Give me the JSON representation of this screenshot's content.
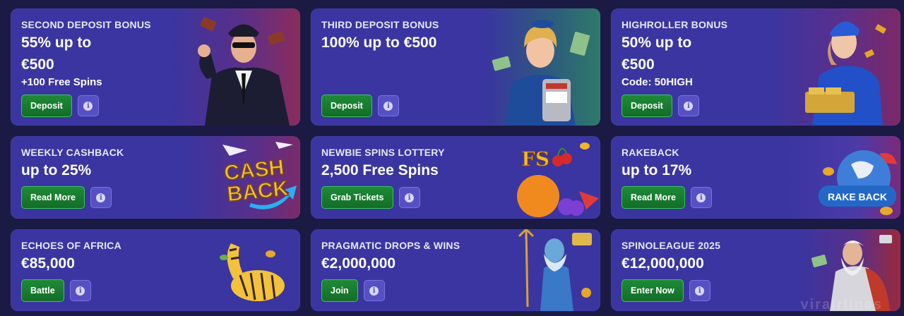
{
  "cards": [
    {
      "eyebrow": "SECOND DEPOSIT BONUS",
      "headline_1": "55% up to",
      "headline_2": "€500",
      "sub": "+100 Free Spins",
      "button": "Deposit",
      "art": "pilot-man-illustration"
    },
    {
      "eyebrow": "THIRD DEPOSIT BONUS",
      "headline_1": "100% up to €500",
      "button": "Deposit",
      "art": "stewardess-slot-machine-illustration"
    },
    {
      "eyebrow": "HIGHROLLER BONUS",
      "headline_1": "50% up to",
      "headline_2": "€500",
      "sub": "Code: 50HIGH",
      "button": "Deposit",
      "art": "stewardess-gold-bars-illustration"
    },
    {
      "eyebrow": "WEEKLY CASHBACK",
      "headline_1": "up to 25%",
      "button": "Read More",
      "art": "cash-back-logo",
      "art_text_1": "CASH",
      "art_text_2": "BACK"
    },
    {
      "eyebrow": "NEWBIE SPINS LOTTERY",
      "headline_1": "2,500 Free Spins",
      "button": "Grab Tickets",
      "art": "fruit-fs-illustration",
      "art_text_1": "FS"
    },
    {
      "eyebrow": "RAKEBACK",
      "headline_1": "up to 17%",
      "button": "Read More",
      "art": "rake-back-globe",
      "art_text_1": "RAKE BACK"
    },
    {
      "eyebrow": "ECHOES OF AFRICA",
      "headline_1": "€85,000",
      "button": "Battle",
      "art": "zebra-illustration"
    },
    {
      "eyebrow": "PRAGMATIC DROPS & WINS",
      "headline_1": "€2,000,000",
      "button": "Join",
      "art": "poseidon-illustration"
    },
    {
      "eyebrow": "SPINOLEAGUE 2025",
      "headline_1": "€12,000,000",
      "button": "Enter Now",
      "art": "zeus-illustration"
    }
  ],
  "info_glyph": "i",
  "watermark": "virairlines",
  "colors": {
    "card_bg": "#3a35a0",
    "page_bg": "#1b1a45",
    "button_green": "#1e8a37",
    "info_bg": "#5650c4"
  }
}
